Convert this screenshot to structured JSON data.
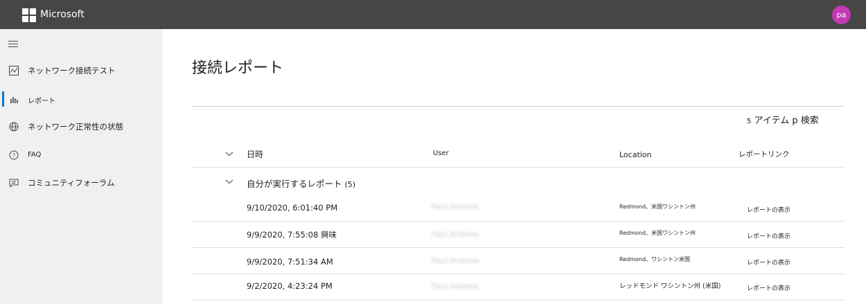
{
  "header": {
    "brand": "Microsoft",
    "avatar_initials": "pa",
    "avatar_color": "#c239b3",
    "bar_color": "#484644"
  },
  "sidebar": {
    "accent": "#0078d4",
    "items": [
      {
        "label": "ネットワーク接続テスト",
        "icon": "chart-image-icon"
      },
      {
        "label": "レポート",
        "icon": "bar-chart-icon"
      },
      {
        "label": "ネットワーク正常性の状態",
        "icon": "globe-health-icon"
      },
      {
        "label": "FAQ",
        "icon": "question-circle-icon"
      },
      {
        "label": "コミュニティフォーラム",
        "icon": "chat-bubble-icon"
      }
    ]
  },
  "main": {
    "title": "接続レポート",
    "items_count": "5",
    "items_search": "アイテム p 検索",
    "columns": [
      "日時",
      "User",
      "Location",
      "レポートリンク"
    ],
    "group": {
      "label": "自分が実行するレポート",
      "count": "(5)"
    },
    "rows": [
      {
        "datetime": "9/10/2020, 6:01:40 PM",
        "user": "Paul Andrew",
        "location": "Redmond、米国ワシントン州",
        "link": "レポートの表示"
      },
      {
        "datetime": "9/9/2020, 7:55:08 興味",
        "user": "Paul Andrew",
        "location": "Redmond、米国ワシントン州",
        "link": "レポートの表示"
      },
      {
        "datetime": "9/9/2020, 7:51:34 AM",
        "user": "Paul Andrew",
        "location": "Redmond、ワシントン米国",
        "link": "レポートの表示"
      },
      {
        "datetime": "9/2/2020, 4:23:24 PM",
        "user": "Paul Andrew",
        "location": "レッドモンド ワシントン州 (米国)",
        "link": "レポートの表示"
      }
    ]
  }
}
